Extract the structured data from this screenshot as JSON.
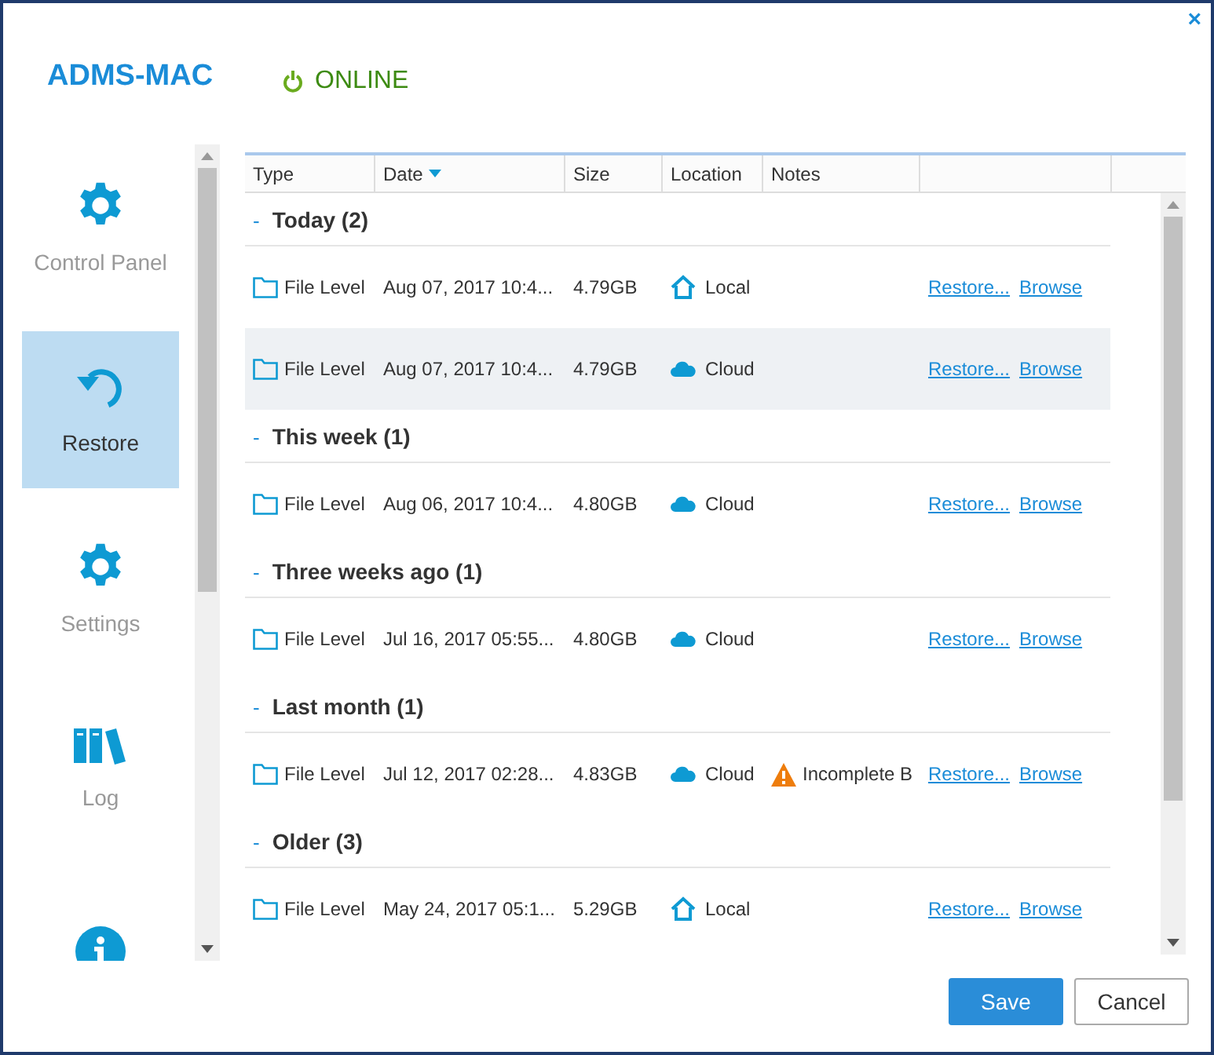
{
  "window": {
    "close": "×"
  },
  "header": {
    "device": "ADMS-MAC",
    "status": {
      "label": "ONLINE",
      "online": true
    }
  },
  "sidebar": {
    "items": [
      {
        "kind": "gear",
        "label": "Control Panel",
        "selected": false
      },
      {
        "kind": "restore",
        "label": "Restore",
        "selected": true
      },
      {
        "kind": "gear",
        "label": "Settings",
        "selected": false
      },
      {
        "kind": "log",
        "label": "Log",
        "selected": false
      },
      {
        "kind": "info",
        "selected": false
      }
    ]
  },
  "table": {
    "columns": [
      {
        "label": "Type",
        "sorted": false
      },
      {
        "label": "Date",
        "sorted": true
      },
      {
        "label": "Size",
        "sorted": false
      },
      {
        "label": "Location",
        "sorted": false
      },
      {
        "label": "Notes",
        "sorted": false
      },
      {
        "sorted": false
      }
    ],
    "groups": [
      {
        "toggle": "-",
        "label": "Today (2)",
        "rows": [
          {
            "type": "File Level",
            "date": "Aug 07, 2017 10:4...",
            "size": "4.79GB",
            "location": {
              "kind": "local",
              "label": "Local"
            },
            "highlighted": false,
            "actions": [
              "Restore...",
              "Browse"
            ]
          },
          {
            "type": "File Level",
            "date": "Aug 07, 2017 10:4...",
            "size": "4.79GB",
            "location": {
              "kind": "cloud",
              "label": "Cloud"
            },
            "highlighted": true,
            "actions": [
              "Restore...",
              "Browse"
            ]
          }
        ]
      },
      {
        "toggle": "-",
        "label": "This week (1)",
        "rows": [
          {
            "type": "File Level",
            "date": "Aug 06, 2017 10:4...",
            "size": "4.80GB",
            "location": {
              "kind": "cloud",
              "label": "Cloud"
            },
            "highlighted": false,
            "actions": [
              "Restore...",
              "Browse"
            ]
          }
        ]
      },
      {
        "toggle": "-",
        "label": "Three weeks ago (1)",
        "rows": [
          {
            "type": "File Level",
            "date": "Jul 16, 2017 05:55...",
            "size": "4.80GB",
            "location": {
              "kind": "cloud",
              "label": "Cloud"
            },
            "highlighted": false,
            "actions": [
              "Restore...",
              "Browse"
            ]
          }
        ]
      },
      {
        "toggle": "-",
        "label": "Last month (1)",
        "rows": [
          {
            "type": "File Level",
            "date": "Jul 12, 2017 02:28...",
            "size": "4.83GB",
            "location": {
              "kind": "cloud",
              "label": "Cloud"
            },
            "notes": {
              "kind": "warning",
              "label": "Incomplete B"
            },
            "highlighted": false,
            "actions": [
              "Restore...",
              "Browse"
            ]
          }
        ]
      },
      {
        "toggle": "-",
        "label": "Older (3)",
        "rows": [
          {
            "type": "File Level",
            "date": "May 24, 2017 05:1...",
            "size": "5.29GB",
            "location": {
              "kind": "local",
              "label": "Local"
            },
            "highlighted": false,
            "actions": [
              "Restore...",
              "Browse"
            ]
          }
        ]
      }
    ]
  },
  "footer": {
    "buttons": [
      {
        "label": "Save",
        "kind": "primary"
      },
      {
        "label": "Cancel",
        "kind": "secondary"
      }
    ]
  }
}
